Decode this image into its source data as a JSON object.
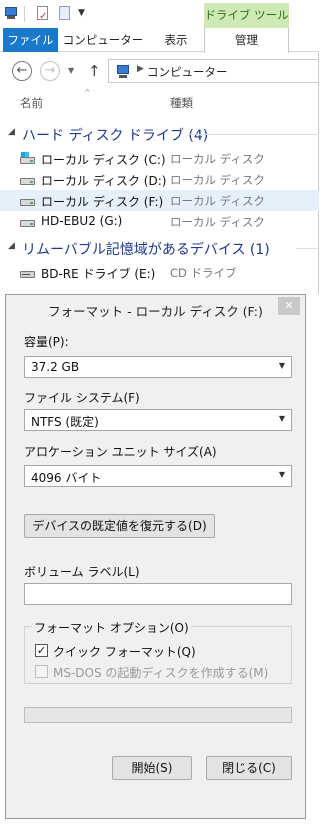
{
  "explorer": {
    "context_tab": "ドライブ ツール",
    "ribbon_tabs": [
      "ファイル",
      "コンピューター",
      "表示",
      "管理"
    ],
    "address": "コンピューター",
    "columns": {
      "name": "名前",
      "type": "種類"
    },
    "groups": [
      {
        "label": "ハード ディスク ドライブ (4)",
        "items": [
          {
            "name": "ローカル ディスク (C:)",
            "type": "ローカル ディスク"
          },
          {
            "name": "ローカル ディスク (D:)",
            "type": "ローカル ディスク"
          },
          {
            "name": "ローカル ディスク (F:)",
            "type": "ローカル ディスク"
          },
          {
            "name": "HD-EBU2 (G:)",
            "type": "ローカル ディスク"
          }
        ]
      },
      {
        "label": "リムーバブル記憶域があるデバイス (1)",
        "items": [
          {
            "name": "BD-RE ドライブ (E:)",
            "type": "CD ドライブ"
          }
        ]
      }
    ]
  },
  "dialog": {
    "title": "フォーマット - ローカル ディスク (F:)",
    "close_glyph": "✕",
    "capacity_label": "容量(P):",
    "capacity_value": "37.2 GB",
    "filesystem_label": "ファイル システム(F)",
    "filesystem_value": "NTFS (既定)",
    "alloc_label": "アロケーション ユニット サイズ(A)",
    "alloc_value": "4096 バイト",
    "restore_button": "デバイスの既定値を復元する(D)",
    "volume_label": "ボリューム ラベル(L)",
    "volume_value": "",
    "options_label": "フォーマット オプション(O)",
    "quick_format_label": "クイック フォーマット(Q)",
    "quick_format_checked": true,
    "msdos_label": "MS-DOS の起動ディスクを作成する(M)",
    "msdos_checked": false,
    "progress": 0,
    "start_button": "開始(S)",
    "close_button": "閉じる(C)"
  },
  "colors": {
    "file_tab": "#1979ca",
    "context_tab_bg": "#cfe9b5",
    "group_header": "#1e3a8a",
    "selected_row": "#e6f0fa"
  }
}
